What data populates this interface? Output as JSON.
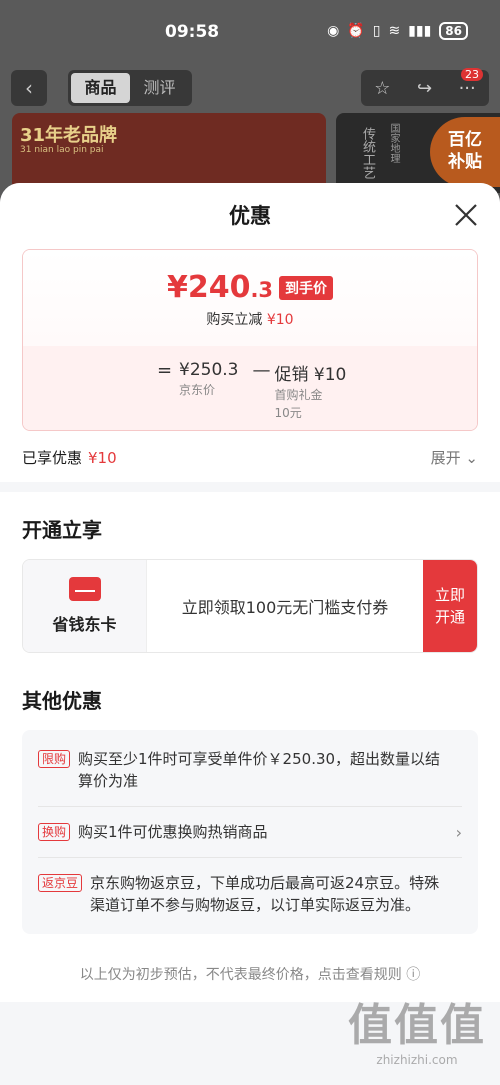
{
  "status_bar": {
    "time": "09:58",
    "battery": "86"
  },
  "nav": {
    "tabs": [
      "商品",
      "测评"
    ],
    "badge": "23"
  },
  "banner": {
    "left_title": "31年老品牌",
    "left_subtitle": "31 nian lao pin pai",
    "right_text": "传统工艺",
    "right_text2": "国家地理",
    "subsidy_line1": "百亿",
    "subsidy_line2": "补贴"
  },
  "sheet": {
    "title": "优惠",
    "price": {
      "currency": "¥",
      "integer": "240",
      "decimal": ".3",
      "tag": "到手价",
      "subtitle_label": "购买立减",
      "subtitle_value": "¥10",
      "eq": "=",
      "minus": "—",
      "base_value": "¥250.3",
      "base_label": "京东价",
      "promo_value": "促销 ¥10",
      "promo_label1": "首购礼金",
      "promo_label2": "10元"
    },
    "enjoyed": {
      "label": "已享优惠",
      "value": "¥10",
      "expand": "展开"
    },
    "open_section": {
      "title": "开通立享",
      "card_name": "省钱东卡",
      "card_desc": "立即领取100元无门槛支付券",
      "button_line1": "立即",
      "button_line2": "开通"
    },
    "other_section": {
      "title": "其他优惠",
      "offers": [
        {
          "tag": "限购",
          "text": "购买至少1件时可享受单件价￥250.30，超出数量以结算价为准"
        },
        {
          "tag": "换购",
          "text": "购买1件可优惠换购热销商品"
        },
        {
          "tag": "返京豆",
          "text": "京东购物返京豆，下单成功后最高可返24京豆。特殊渠道订单不参与购物返豆，以订单实际返豆为准。"
        }
      ]
    },
    "footer_note": "以上仅为初步预估，不代表最终价格，点击查看规则",
    "watermark_big": "值值值",
    "watermark_small": "zhizhizhi.com"
  }
}
